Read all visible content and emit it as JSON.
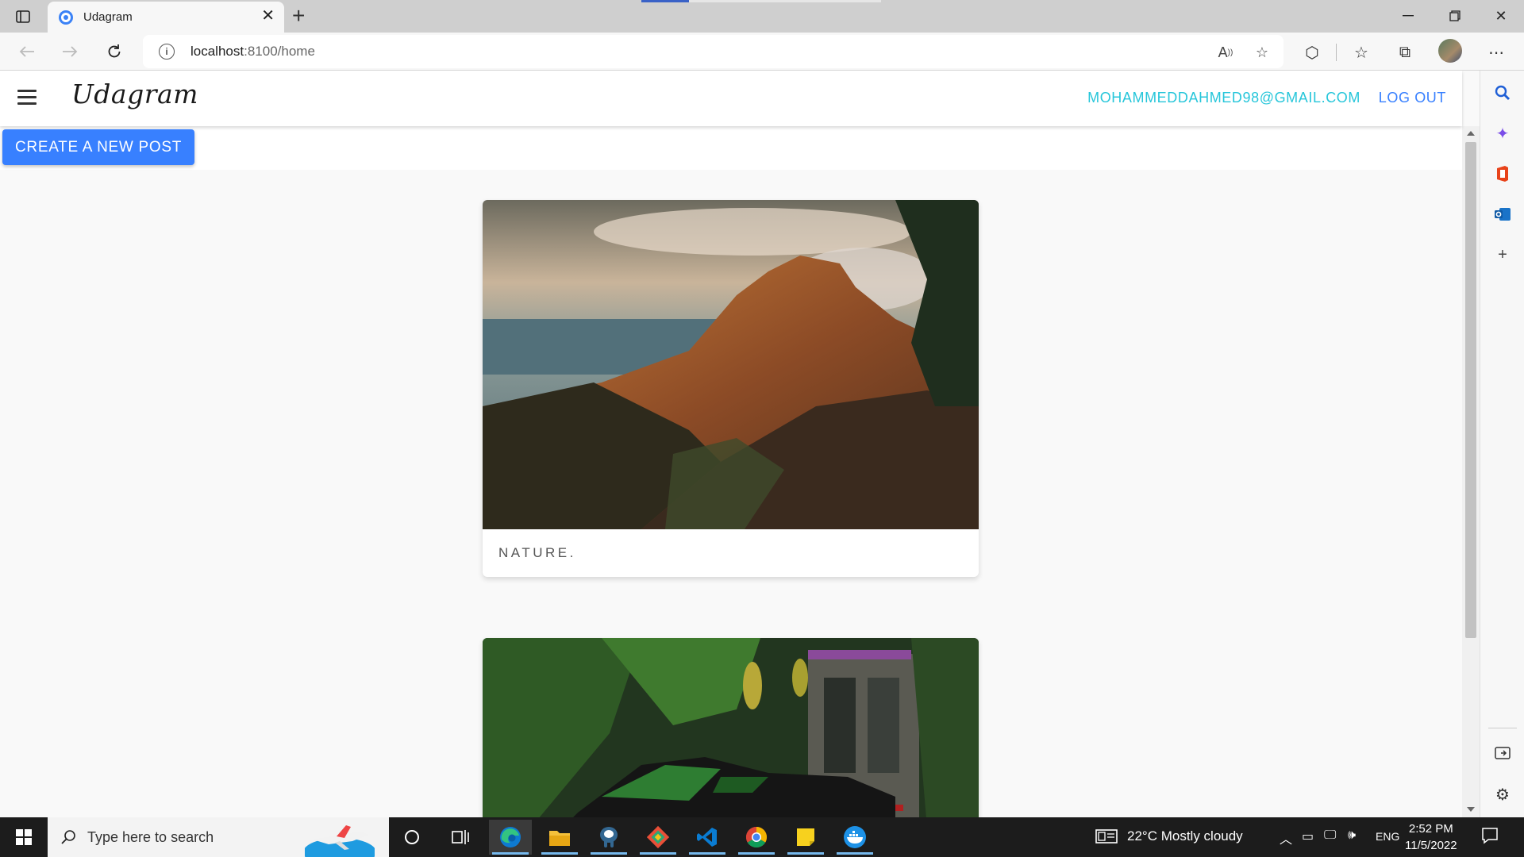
{
  "browser": {
    "tab_title": "Udagram",
    "address_host": "localhost",
    "address_path": ":8100/home"
  },
  "app": {
    "brand": "Udagram",
    "user_email": "MOHAMMEDDAHMED98@GMAIL.COM",
    "logout_label": "LOG OUT",
    "create_post_label": "CREATE A NEW POST"
  },
  "feed": {
    "posts": [
      {
        "caption": "NATURE.",
        "image": "mountain-valley-photo"
      },
      {
        "caption": "",
        "image": "motorcycle-photo"
      }
    ]
  },
  "taskbar": {
    "search_placeholder": "Type here to search",
    "weather": "22°C  Mostly cloudy",
    "language": "ENG",
    "time": "2:52 PM",
    "date": "11/5/2022"
  },
  "colors": {
    "accent": "#3880ff",
    "email": "#26c6da",
    "taskbar": "#1c1c1c"
  }
}
